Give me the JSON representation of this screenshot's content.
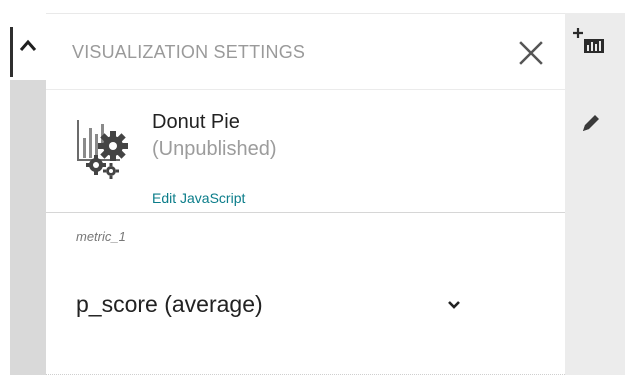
{
  "panel": {
    "title": "VISUALIZATION SETTINGS",
    "close_icon": "close-icon"
  },
  "visualization": {
    "icon": "chart-gears-icon",
    "name": "Donut Pie",
    "status": "(Unpublished)",
    "edit_link": "Edit JavaScript"
  },
  "metric": {
    "label": "metric_1",
    "selected": "p_score (average)",
    "chevron_icon": "chevron-down-icon"
  },
  "tools": {
    "add_chart_icon": "add-chart-icon",
    "edit_icon": "pencil-icon"
  },
  "left_strip": {
    "collapse_icon": "chevron-up-icon"
  },
  "colors": {
    "link": "#0b7d8a",
    "title": "#9a9a9a",
    "tool_bg": "#ececec",
    "strip_bg": "#d9d9d9"
  }
}
